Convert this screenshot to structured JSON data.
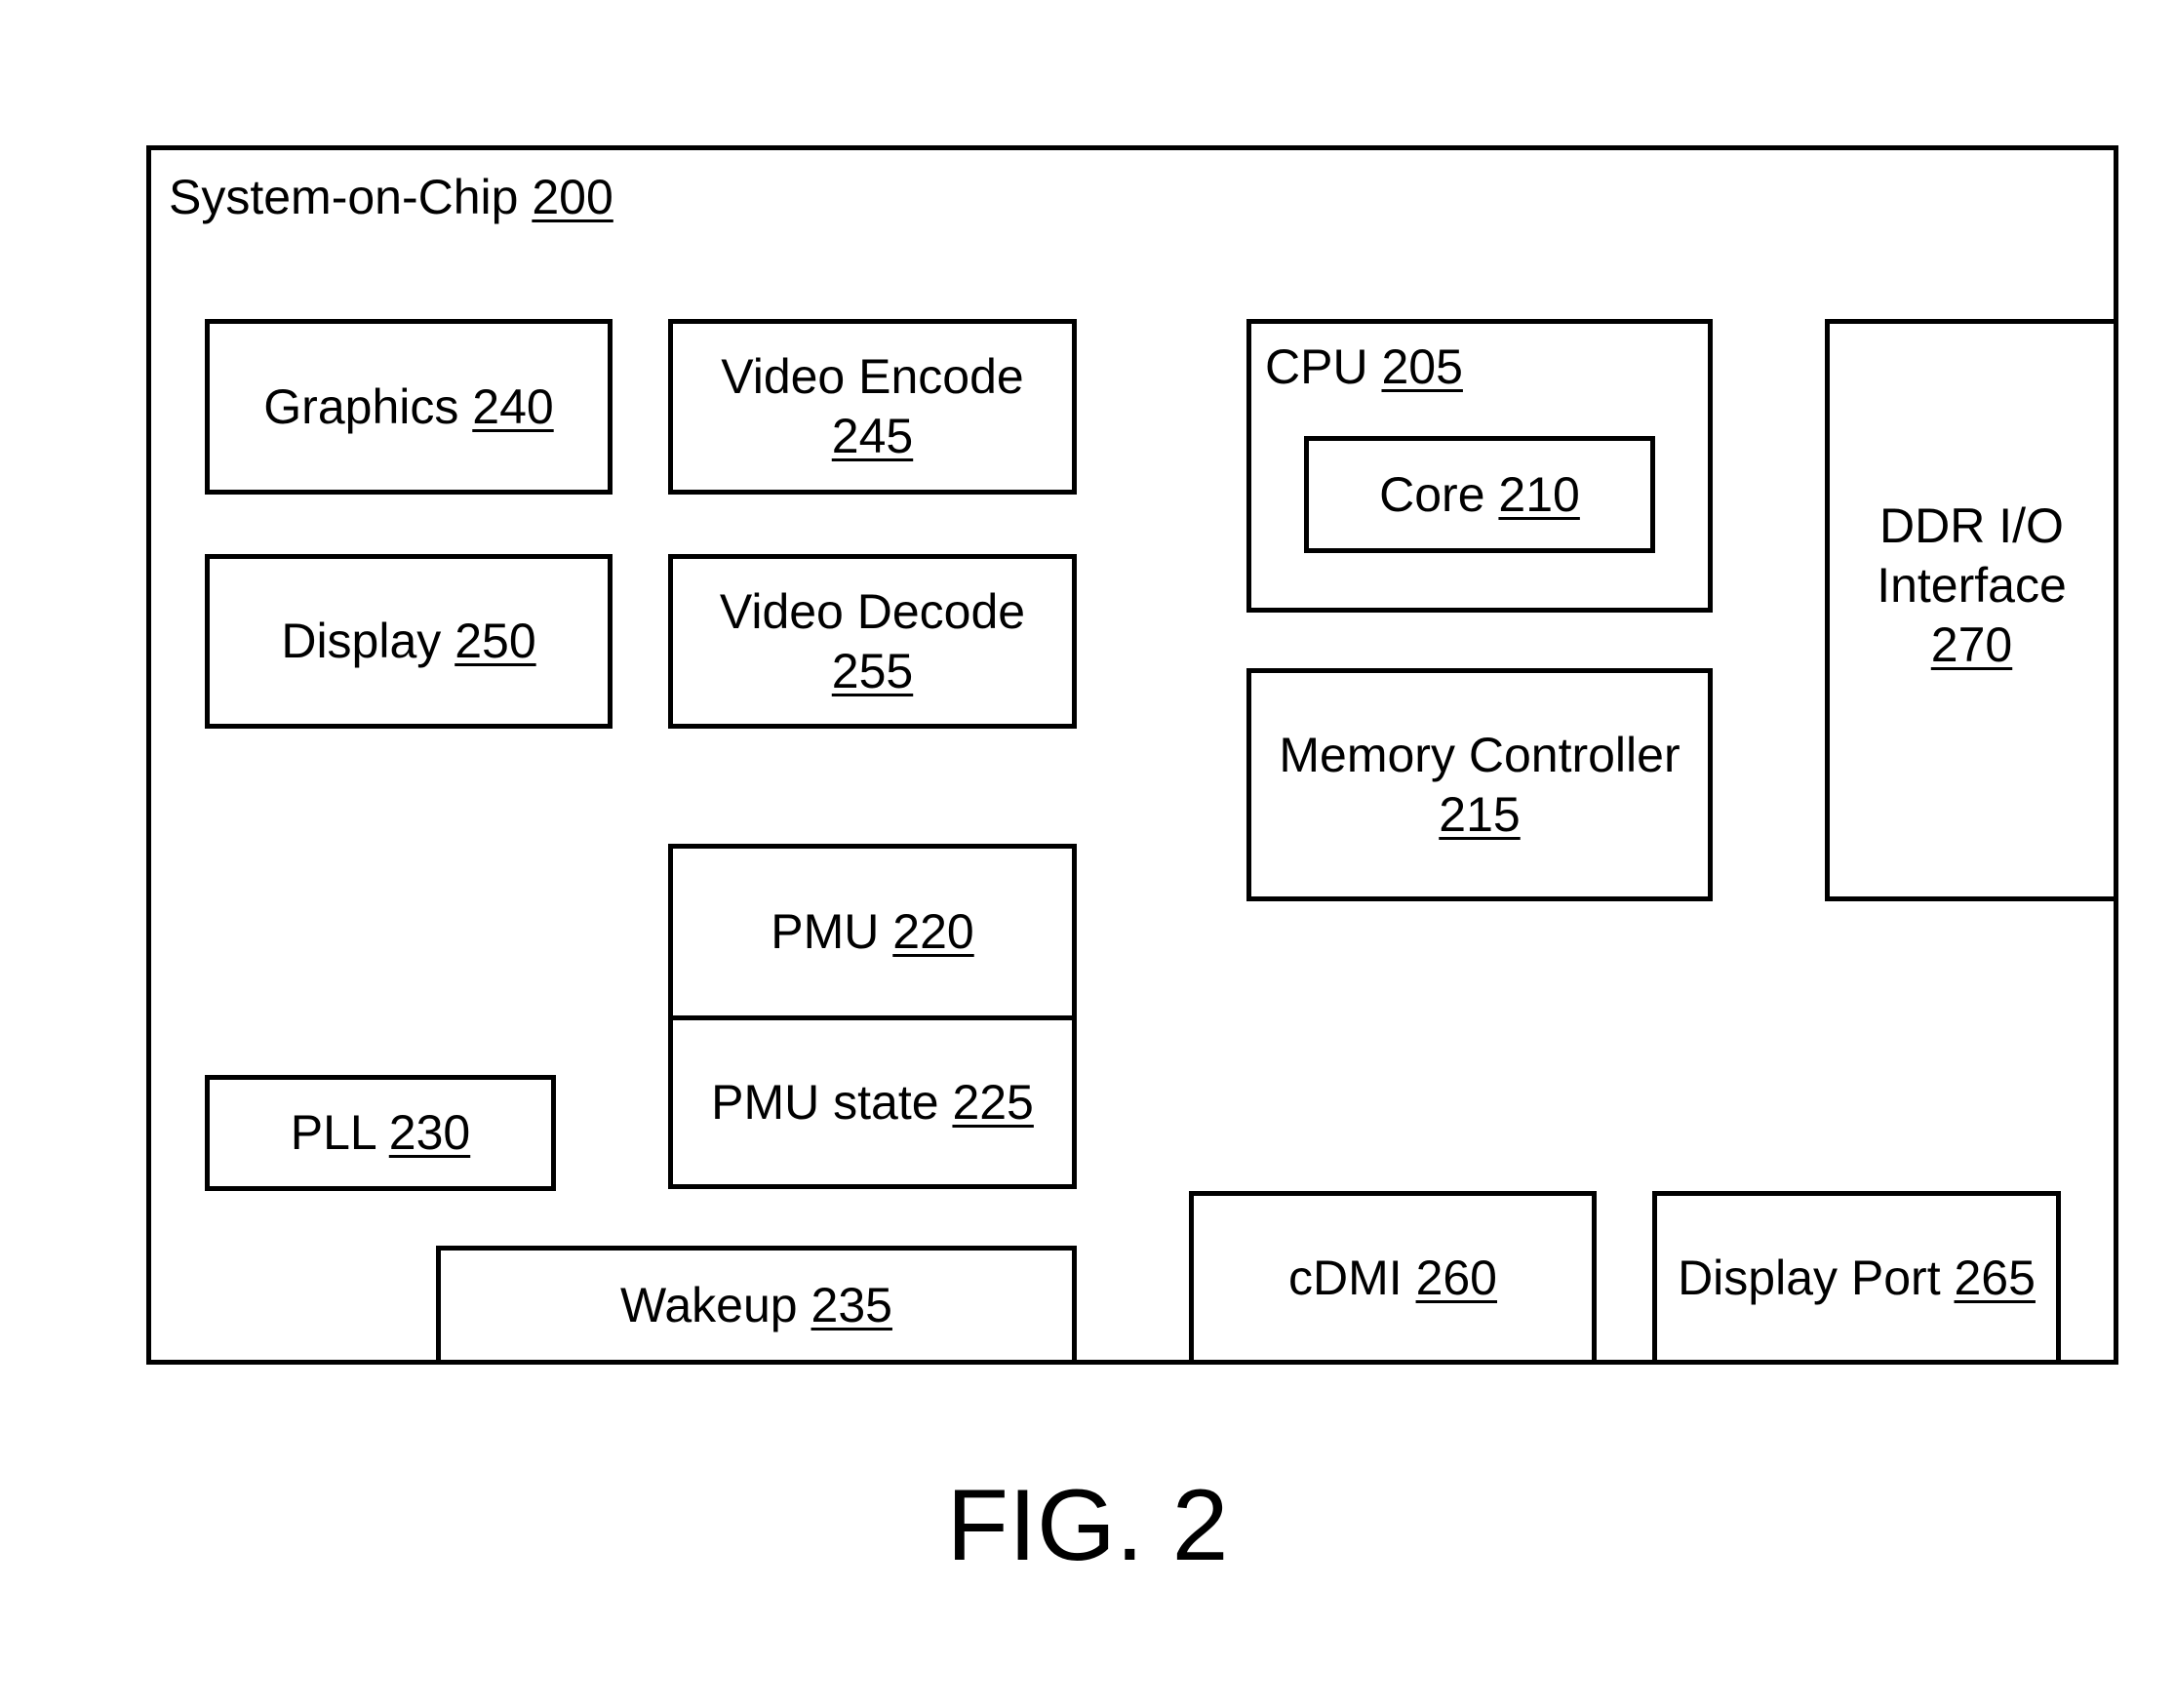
{
  "figure_label": "FIG. 2",
  "soc": {
    "name": "System-on-Chip",
    "ref": "200"
  },
  "blocks": {
    "graphics": {
      "name": "Graphics",
      "ref": "240"
    },
    "video_encode": {
      "name": "Video Encode",
      "ref": "245"
    },
    "display": {
      "name": "Display",
      "ref": "250"
    },
    "video_decode": {
      "name": "Video Decode",
      "ref": "255"
    },
    "cpu": {
      "name": "CPU",
      "ref": "205"
    },
    "core": {
      "name": "Core",
      "ref": "210"
    },
    "memory_controller": {
      "name": "Memory Controller",
      "ref": "215"
    },
    "ddr_io": {
      "name_line1": "DDR I/O",
      "name_line2": "Interface",
      "ref": "270"
    },
    "pmu": {
      "name": "PMU",
      "ref": "220"
    },
    "pmu_state": {
      "name": "PMU state",
      "ref": "225"
    },
    "pll": {
      "name": "PLL",
      "ref": "230"
    },
    "wakeup": {
      "name": "Wakeup",
      "ref": "235"
    },
    "cdmi": {
      "name": "cDMI",
      "ref": "260"
    },
    "display_port": {
      "name": "Display Port",
      "ref": "265"
    }
  }
}
